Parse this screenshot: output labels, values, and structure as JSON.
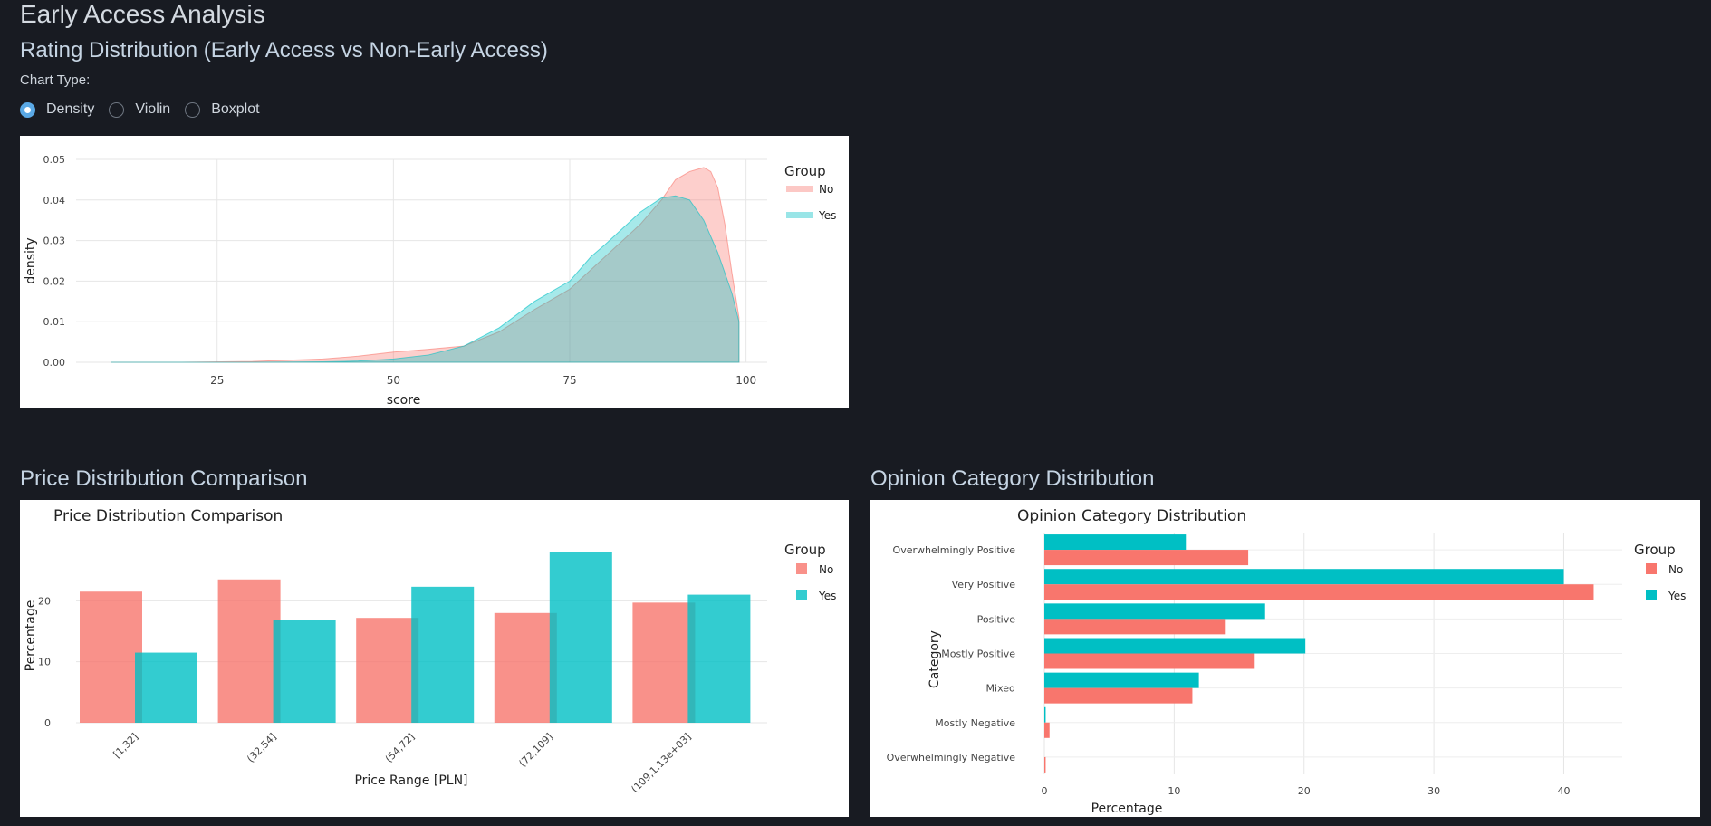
{
  "app": {
    "title": "Early Access Analysis"
  },
  "rating": {
    "section_title": "Rating Distribution (Early Access vs Non-Early Access)",
    "chart_type_label": "Chart Type:",
    "options": [
      "Density",
      "Violin",
      "Boxplot"
    ],
    "selected": "Density"
  },
  "price": {
    "section_title": "Price Distribution Comparison"
  },
  "opinion": {
    "section_title": "Opinion Category Distribution"
  },
  "colors": {
    "no": "#f8766d",
    "yes": "#00bfc4",
    "background": "#181b22"
  },
  "chart_data": [
    {
      "type": "area",
      "title": "",
      "xlabel": "score",
      "ylabel": "density",
      "xlim": [
        5,
        103
      ],
      "ylim": [
        0,
        0.05
      ],
      "xticks": [
        25,
        50,
        75,
        100
      ],
      "yticks": [
        "0.00",
        "0.01",
        "0.02",
        "0.03",
        "0.04",
        "0.05"
      ],
      "legend": {
        "title": "Group",
        "position": "right"
      },
      "series": [
        {
          "name": "No",
          "color": "#f8766d",
          "x": [
            10,
            20,
            30,
            40,
            45,
            50,
            55,
            60,
            65,
            70,
            75,
            80,
            85,
            88,
            90,
            92,
            94,
            95,
            96,
            97,
            98,
            99
          ],
          "y": [
            0,
            0,
            0.0002,
            0.0008,
            0.0015,
            0.0025,
            0.0032,
            0.004,
            0.0075,
            0.013,
            0.018,
            0.026,
            0.034,
            0.04,
            0.045,
            0.047,
            0.048,
            0.047,
            0.043,
            0.034,
            0.022,
            0.011
          ]
        },
        {
          "name": "Yes",
          "color": "#00bfc4",
          "x": [
            10,
            20,
            30,
            40,
            45,
            50,
            55,
            60,
            65,
            70,
            75,
            78,
            80,
            85,
            88,
            90,
            92,
            94,
            96,
            98,
            99
          ],
          "y": [
            0,
            0,
            0,
            0.0001,
            0.0003,
            0.0008,
            0.0018,
            0.004,
            0.0085,
            0.015,
            0.02,
            0.026,
            0.029,
            0.037,
            0.0405,
            0.041,
            0.04,
            0.035,
            0.027,
            0.017,
            0.01
          ]
        }
      ]
    },
    {
      "type": "bar",
      "title": "Price Distribution Comparison",
      "xlabel": "Price Range [PLN]",
      "ylabel": "Percentage",
      "ylim": [
        0,
        30
      ],
      "yticks": [
        0,
        10,
        20
      ],
      "categories": [
        "[1,32]",
        "(32,54]",
        "(54,72]",
        "(72,109]",
        "(109,1.13e+03]"
      ],
      "legend": {
        "title": "Group",
        "position": "right"
      },
      "series": [
        {
          "name": "No",
          "color": "#f8766d",
          "values": [
            21.5,
            23.5,
            17.2,
            18.0,
            19.7
          ]
        },
        {
          "name": "Yes",
          "color": "#00bfc4",
          "values": [
            11.5,
            16.8,
            22.3,
            28.0,
            21.0
          ]
        }
      ]
    },
    {
      "type": "bar",
      "orientation": "horizontal",
      "title": "Opinion Category Distribution",
      "xlabel": "Percentage",
      "ylabel": "Category",
      "xlim": [
        0,
        44.5
      ],
      "xticks": [
        0,
        10,
        20,
        30,
        40
      ],
      "categories": [
        "Overwhelmingly Positive",
        "Very Positive",
        "Positive",
        "Mostly Positive",
        "Mixed",
        "Mostly Negative",
        "Overwhelmingly Negative"
      ],
      "legend": {
        "title": "Group",
        "position": "right"
      },
      "series": [
        {
          "name": "No",
          "color": "#f8766d",
          "values": [
            15.7,
            42.3,
            13.9,
            16.2,
            11.4,
            0.4,
            0.1
          ]
        },
        {
          "name": "Yes",
          "color": "#00bfc4",
          "values": [
            10.9,
            40.0,
            17.0,
            20.1,
            11.9,
            0.1,
            0
          ]
        }
      ]
    }
  ]
}
